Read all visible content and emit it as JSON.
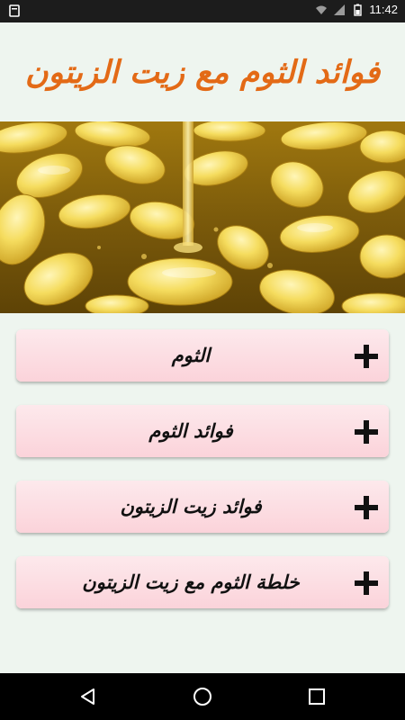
{
  "status_bar": {
    "time": "11:42",
    "left_icon": "notification-icon",
    "right_icons": [
      "wifi-icon",
      "signal-icon",
      "battery-icon"
    ]
  },
  "header": {
    "title": "فوائد الثوم مع زيت الزيتون",
    "title_color": "#e36a16"
  },
  "hero_image": {
    "subject": "garlic cloves in olive oil"
  },
  "menu": {
    "items": [
      {
        "label": "الثوم",
        "icon": "plus-icon"
      },
      {
        "label": "فوائد الثوم",
        "icon": "plus-icon"
      },
      {
        "label": "فوائد زيت الزيتون",
        "icon": "plus-icon"
      },
      {
        "label": "خلطة الثوم مع زيت الزيتون",
        "icon": "plus-icon"
      }
    ],
    "item_background": "#fbd9df"
  },
  "nav_bar": {
    "buttons": [
      "back-icon",
      "home-icon",
      "recents-icon"
    ]
  }
}
